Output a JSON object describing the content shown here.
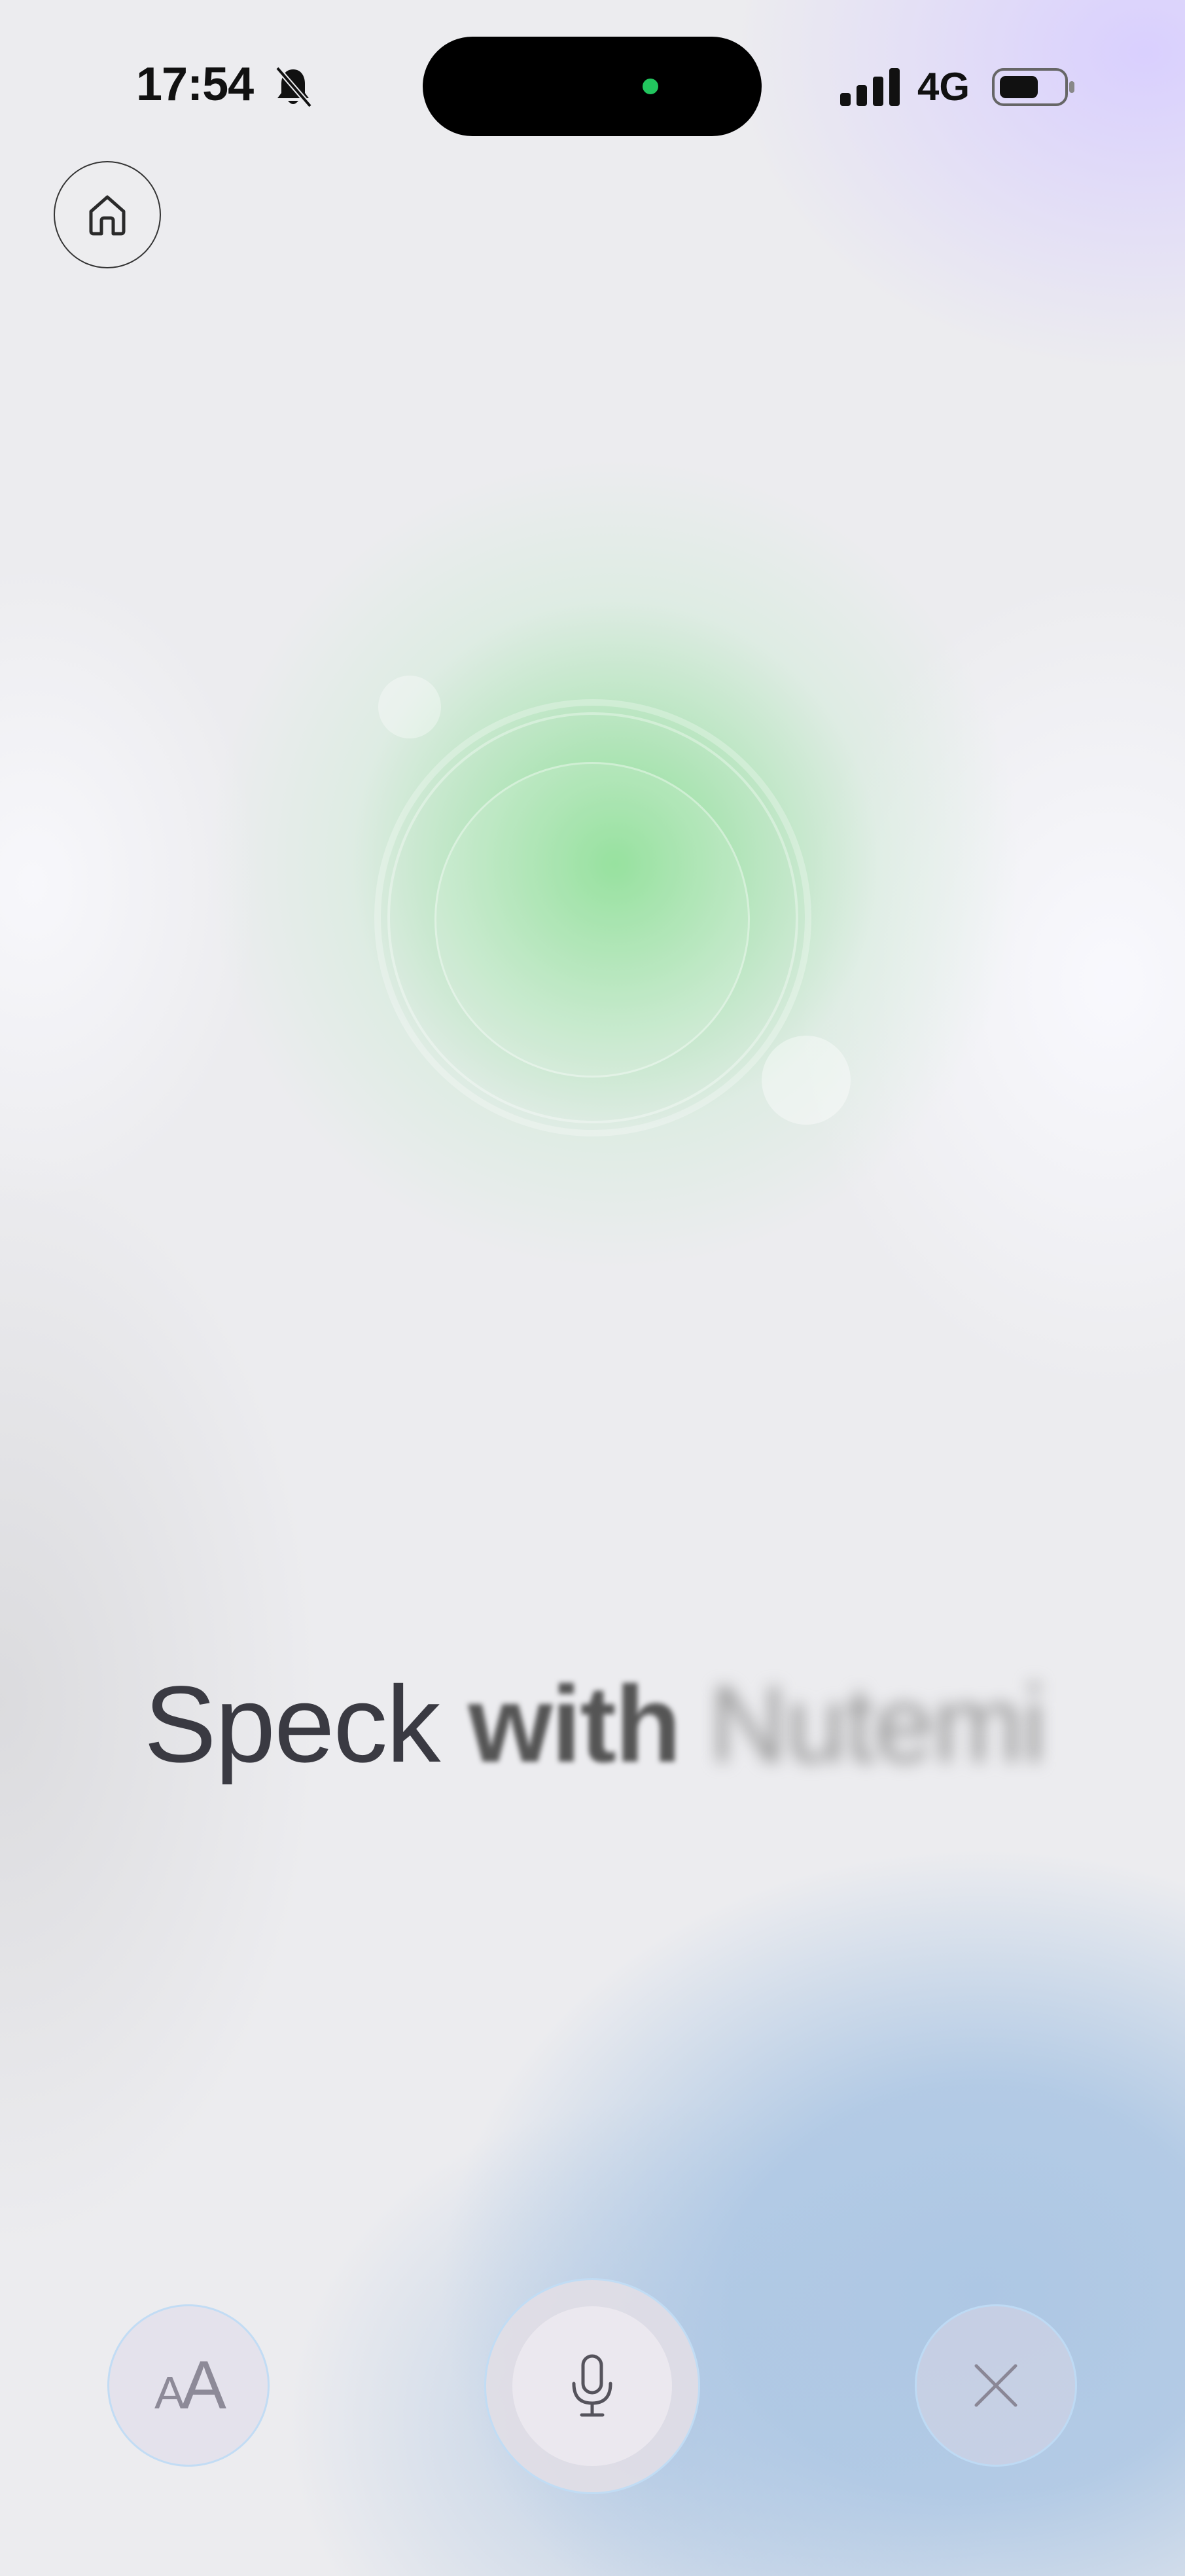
{
  "status_bar": {
    "time": "17:54",
    "network": "4G",
    "icons": [
      "bell-slash-icon",
      "signal-icon",
      "battery-icon"
    ],
    "recording_dot_color": "#22c55e"
  },
  "home_button": {
    "icon": "home-icon"
  },
  "headline": {
    "word1": "Speck",
    "word2": "with",
    "word3": "Nutemi"
  },
  "controls": {
    "text_size": {
      "icon": "text-size-icon",
      "label_small": "A",
      "label_large": "A"
    },
    "mic": {
      "icon": "microphone-icon"
    },
    "close": {
      "icon": "close-icon"
    }
  },
  "colors": {
    "orb_green": "#7fe08a",
    "bg_purple": "#d8ceff",
    "bg_blue": "#adc7e4",
    "text_dark": "#3a3a42"
  }
}
